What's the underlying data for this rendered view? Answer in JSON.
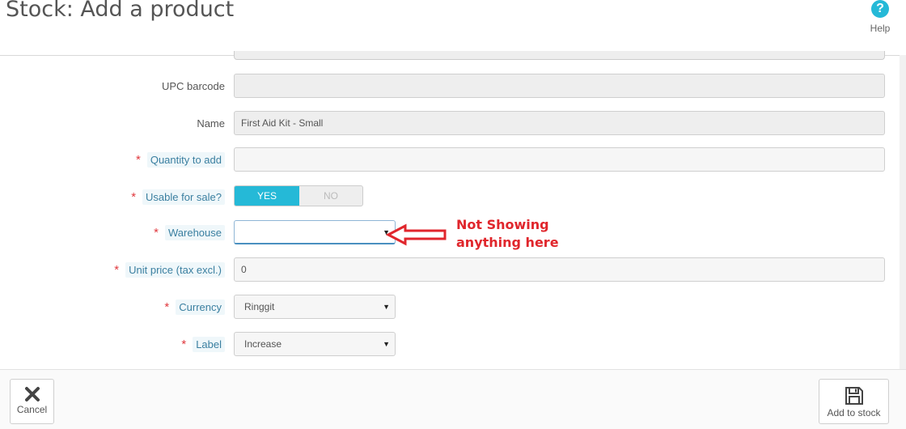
{
  "header": {
    "title": "Stock: Add a product",
    "help_label": "Help",
    "help_glyph": "?"
  },
  "form": {
    "upc": {
      "label": "UPC barcode",
      "value": ""
    },
    "name": {
      "label": "Name",
      "value": "First Aid Kit - Small"
    },
    "quantity": {
      "required_mark": "*",
      "label": "Quantity to add",
      "value": ""
    },
    "usable": {
      "required_mark": "*",
      "label": "Usable for sale?",
      "yes_label": "YES",
      "no_label": "NO",
      "selected": "YES"
    },
    "warehouse": {
      "required_mark": "*",
      "label": "Warehouse",
      "value": ""
    },
    "unit_price": {
      "required_mark": "*",
      "label": "Unit price (tax excl.)",
      "value": "0"
    },
    "currency": {
      "required_mark": "*",
      "label": "Currency",
      "value": "Ringgit"
    },
    "stock_label": {
      "required_mark": "*",
      "label": "Label",
      "value": "Increase"
    }
  },
  "annotation": {
    "line1": "Not Showing",
    "line2": "anything here",
    "color": "#e0262c"
  },
  "footer": {
    "cancel_label": "Cancel",
    "add_label": "Add to stock"
  },
  "colors": {
    "accent": "#25b9d7",
    "required": "#e0393e"
  }
}
